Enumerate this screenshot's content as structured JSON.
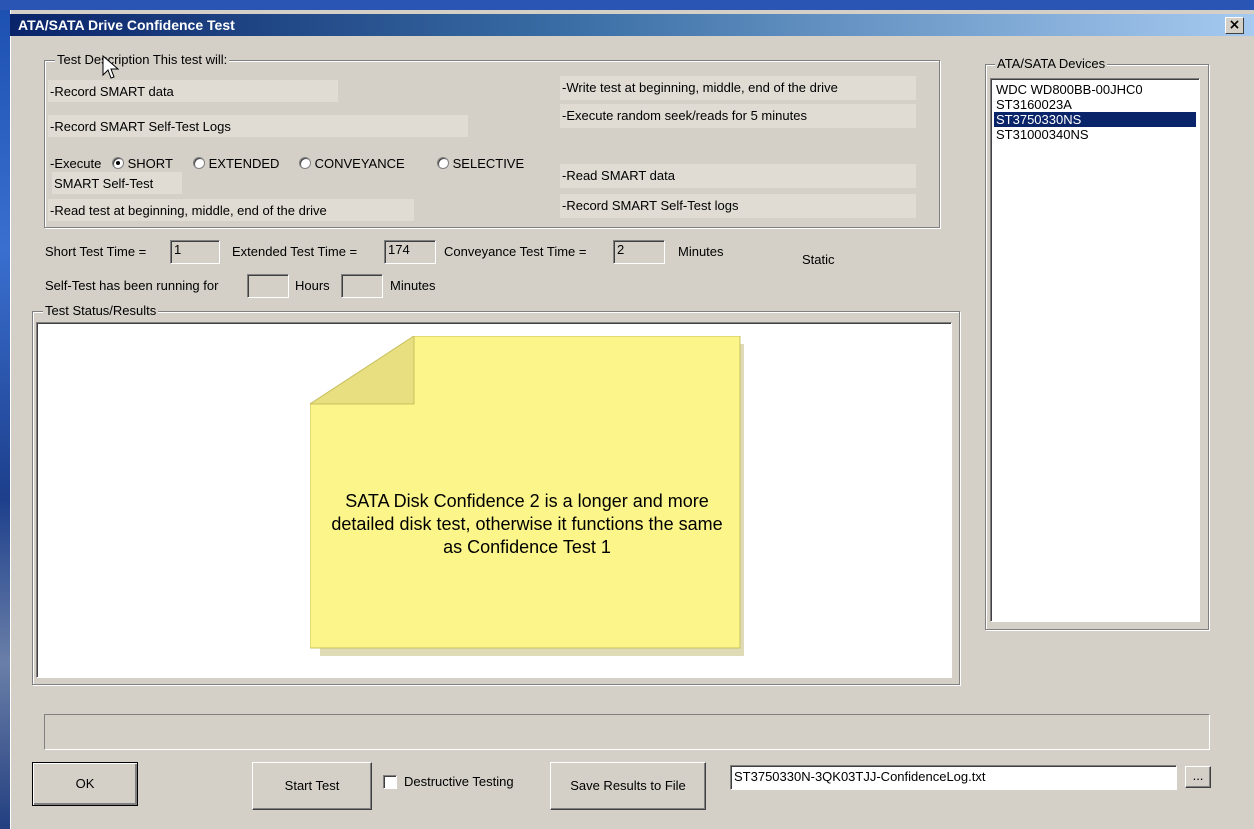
{
  "window": {
    "title": "ATA/SATA Drive Confidence Test",
    "close_glyph": "×"
  },
  "description": {
    "legend": "Test Description This test will:",
    "left": [
      "-Record SMART data",
      "-Record SMART Self-Test Logs",
      "-Read test at beginning, middle, end of the drive"
    ],
    "execute_label": "-Execute",
    "execute_suffix": "SMART Self-Test",
    "options": [
      {
        "label": "SHORT",
        "selected": true
      },
      {
        "label": "EXTENDED",
        "selected": false
      },
      {
        "label": "CONVEYANCE",
        "selected": false
      },
      {
        "label": "SELECTIVE",
        "selected": false
      }
    ],
    "right": [
      "-Write test at beginning, middle, end of the drive",
      "-Execute random seek/reads for 5 minutes",
      "-Read SMART data",
      "-Record SMART Self-Test logs"
    ]
  },
  "times": {
    "short_label": "Short Test Time =",
    "short_value": "1",
    "extended_label": "Extended Test Time =",
    "extended_value": "174",
    "conveyance_label": "Conveyance Test Time =",
    "conveyance_value": "2",
    "minutes_label": "Minutes",
    "static_label": "Static",
    "running_label": "Self-Test has been running for",
    "hours_value": "",
    "hours_label": "Hours",
    "minutes_value": "",
    "minutes_label2": "Minutes"
  },
  "results": {
    "legend": "Test Status/Results",
    "note": "SATA Disk Confidence 2 is a longer and more detailed disk test, otherwise it functions the same as Confidence Test 1",
    "note_color": "#fbf58a"
  },
  "devices": {
    "legend": "ATA/SATA Devices",
    "items": [
      {
        "label": "WDC WD800BB-00JHC0",
        "selected": false
      },
      {
        "label": "ST3160023A",
        "selected": false
      },
      {
        "label": "ST3750330NS",
        "selected": true
      },
      {
        "label": "ST31000340NS",
        "selected": false
      }
    ]
  },
  "footer": {
    "ok_label": "OK",
    "start_label": "Start Test",
    "destructive_label": "Destructive Testing",
    "save_label": "Save Results to File",
    "filename": "ST3750330N-3QK03TJJ-ConfidenceLog.txt",
    "browse_label": "..."
  },
  "icons": {
    "cursor": "mouse-pointer-icon"
  }
}
